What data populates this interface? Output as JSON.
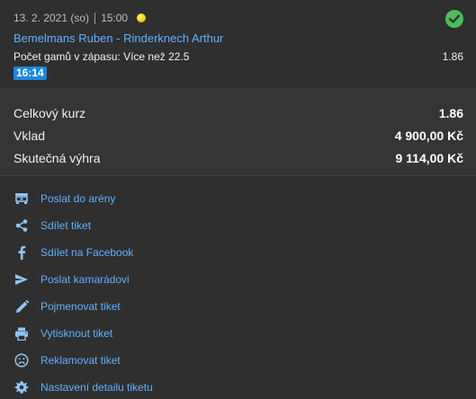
{
  "bet": {
    "date": "13. 2. 2021 (so)",
    "time": "15:00",
    "match": "Bemelmans Ruben - Rinderknech Arthur",
    "market": "Počet gamů v zápasu: Více než 22.5",
    "odds": "1.86",
    "live_time": "16:14",
    "status": "won"
  },
  "summary": {
    "rows": [
      {
        "label": "Celkový kurz",
        "value": "1.86"
      },
      {
        "label": "Vklad",
        "value": "4 900,00 Kč"
      },
      {
        "label": "Skutečná výhra",
        "value": "9 114,00 Kč"
      }
    ]
  },
  "actions": [
    {
      "label": "Poslat do arény",
      "icon": "arena-icon"
    },
    {
      "label": "Sdílet tiket",
      "icon": "share-icon"
    },
    {
      "label": "Sdílet na Facebook",
      "icon": "facebook-icon"
    },
    {
      "label": "Poslat kamarádovi",
      "icon": "send-icon"
    },
    {
      "label": "Pojmenovat tiket",
      "icon": "pencil-icon"
    },
    {
      "label": "Vytisknout tiket",
      "icon": "printer-icon"
    },
    {
      "label": "Reklamovat tiket",
      "icon": "sad-face-icon"
    },
    {
      "label": "Nastavení detailu tiketu",
      "icon": "gear-icon"
    }
  ],
  "colors": {
    "accent": "#5cb2ff",
    "success": "#4cbd5a",
    "live_badge": "#1c87e0"
  }
}
